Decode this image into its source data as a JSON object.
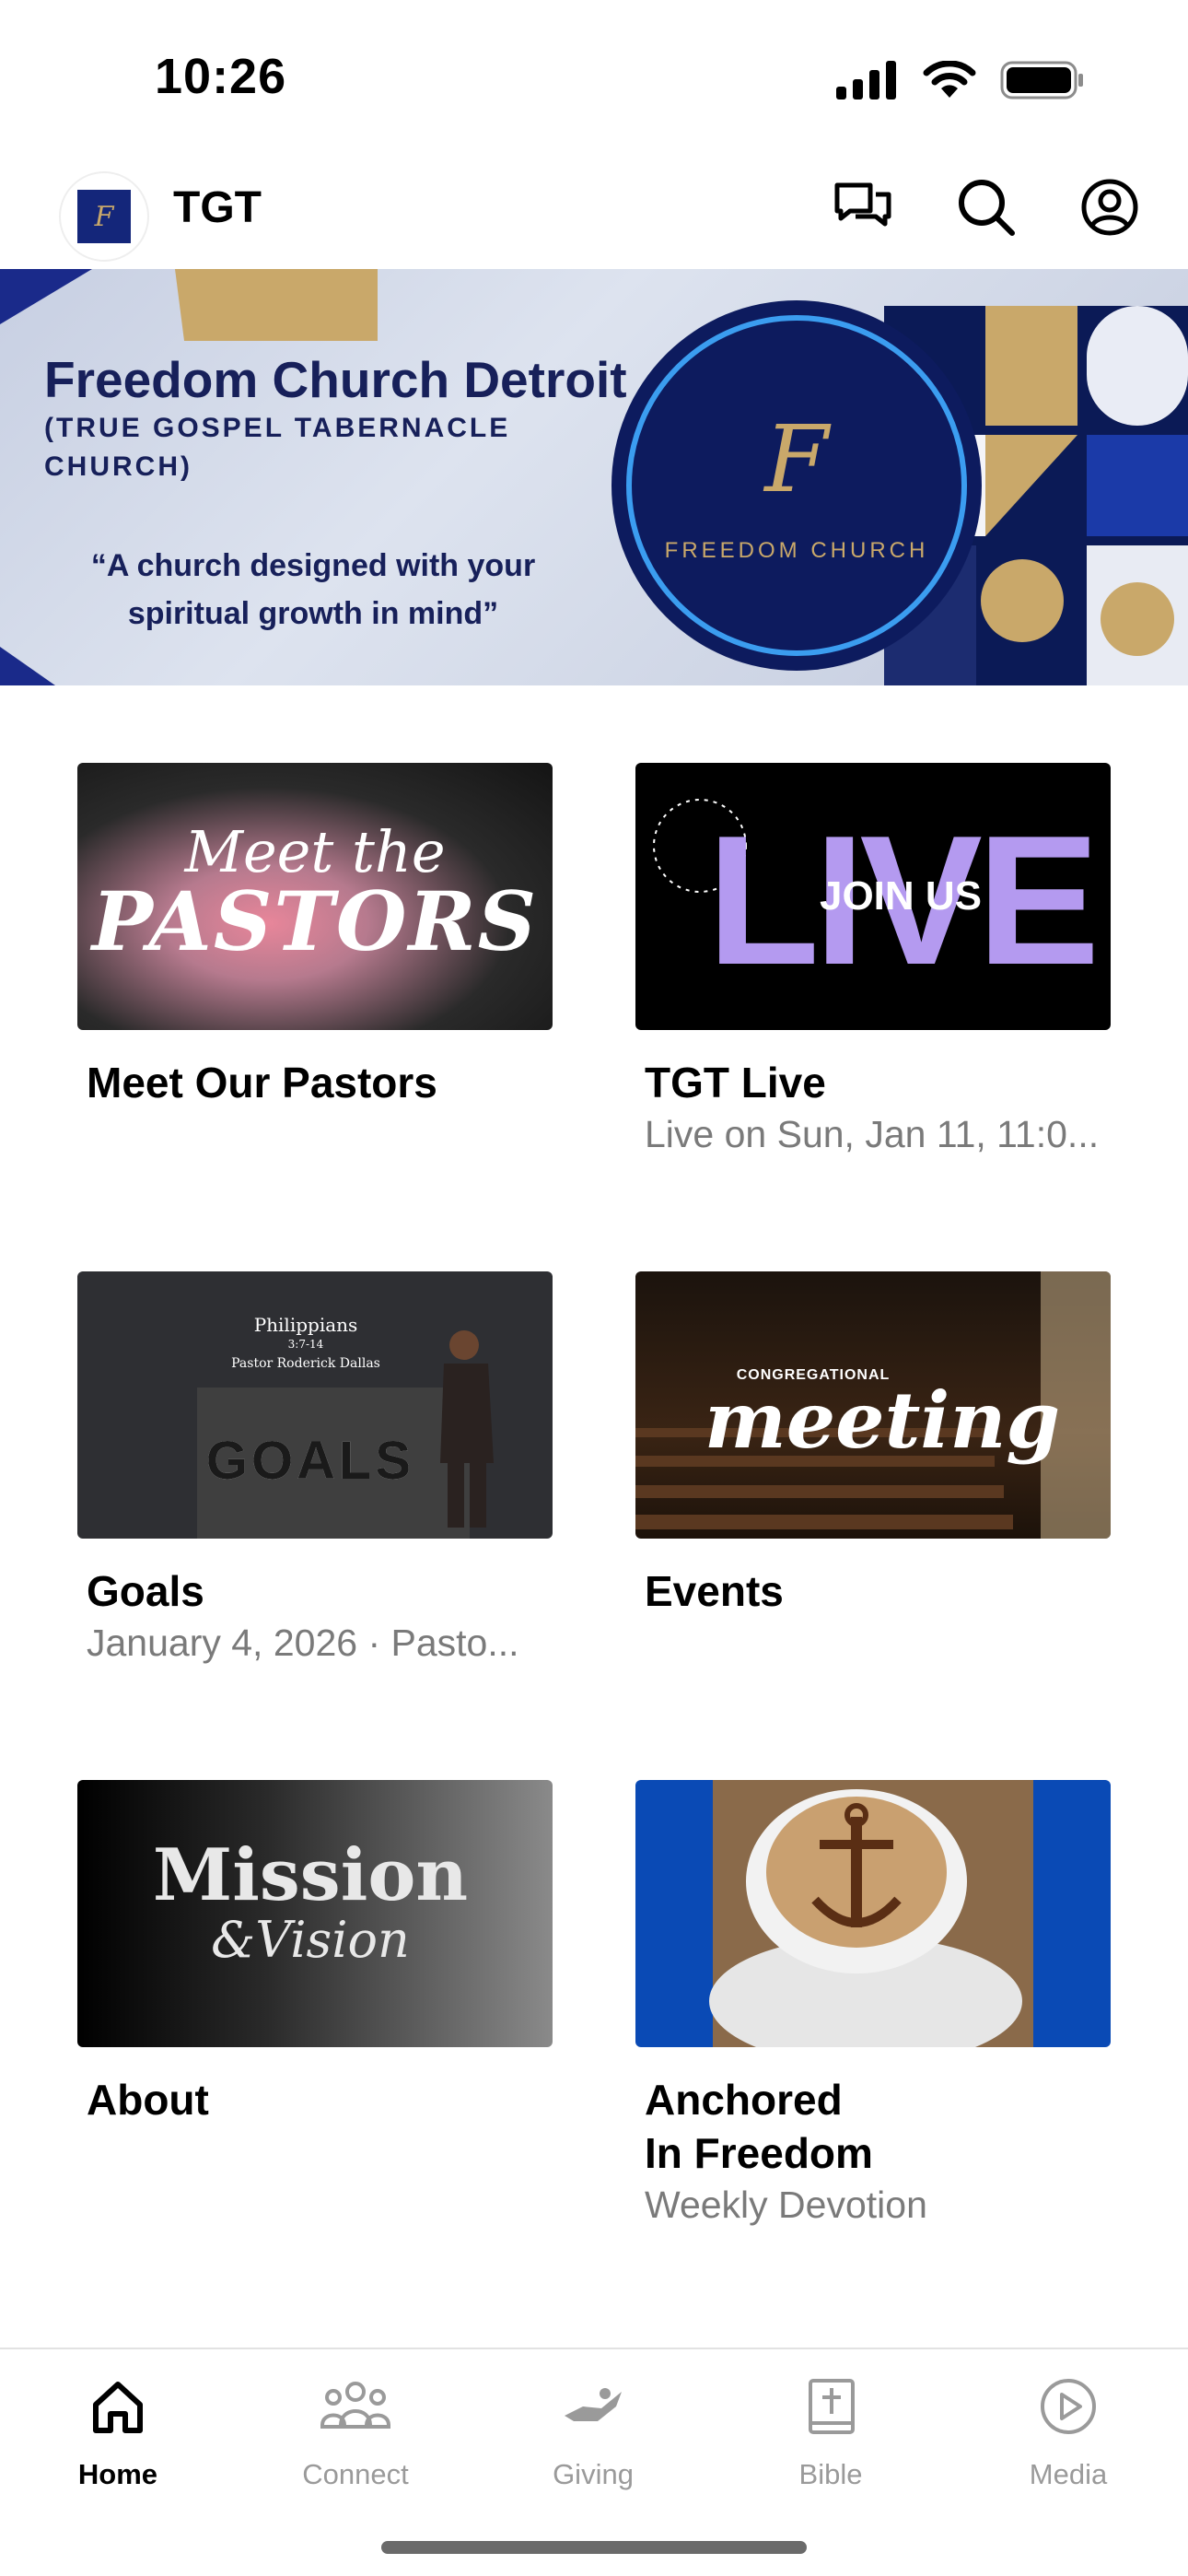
{
  "status_bar": {
    "time": "10:26"
  },
  "header": {
    "app_title": "TGT"
  },
  "hero": {
    "title": "Freedom Church Detroit",
    "subtitle": "(TRUE GOSPEL TABERNACLE CHURCH)",
    "quote": "“A church designed with your spiritual growth in mind”",
    "logo_mark": "F",
    "logo_text": "FREEDOM CHURCH"
  },
  "cards": [
    {
      "title": "Meet Our Pastors",
      "subtitle": "",
      "thumb_line1": "Meet the",
      "thumb_line2": "PASTORS"
    },
    {
      "title": "TGT Live",
      "subtitle": "Live on Sun, Jan 11, 11:0...",
      "thumb_line1": "LIVE",
      "thumb_line2": "JOIN US"
    },
    {
      "title": "Goals",
      "subtitle": "January 4, 2026 · Pasto...",
      "thumb_line1": "Philippians",
      "thumb_line2": "3:7-14",
      "thumb_line3": "Pastor Roderick Dallas",
      "thumb_line4": "GOALS"
    },
    {
      "title": "Events",
      "subtitle": "",
      "thumb_line1": "CONGREGATIONAL",
      "thumb_line2": "meeting"
    },
    {
      "title": "About",
      "subtitle": "",
      "thumb_line1": "Mission",
      "thumb_line2": "&Vision"
    },
    {
      "title": "Anchored\nIn Freedom",
      "title_line1": "Anchored",
      "title_line2": "In Freedom",
      "subtitle": "Weekly Devotion"
    }
  ],
  "bottom_nav": {
    "items": [
      {
        "label": "Home",
        "icon": "home-icon",
        "active": true
      },
      {
        "label": "Connect",
        "icon": "people-icon",
        "active": false
      },
      {
        "label": "Giving",
        "icon": "giving-hand-icon",
        "active": false
      },
      {
        "label": "Bible",
        "icon": "bible-icon",
        "active": false
      },
      {
        "label": "Media",
        "icon": "play-circle-icon",
        "active": false
      }
    ]
  },
  "colors": {
    "accent": "#000000",
    "inactive": "#9a9a9a",
    "brand_navy": "#17205a",
    "brand_gold": "#c9a86a"
  }
}
